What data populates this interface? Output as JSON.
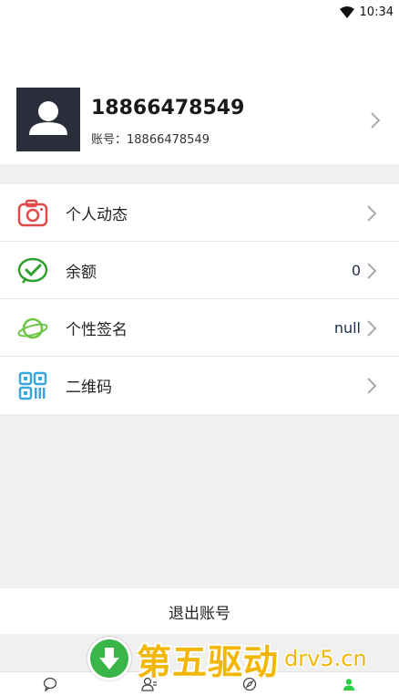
{
  "status_bar": {
    "time": "10:34",
    "wifi_icon": "wifi-icon"
  },
  "profile": {
    "name": "18866478549",
    "account_label": "账号：18866478549",
    "avatar_icon": "user-silhouette-icon"
  },
  "menu": {
    "items": [
      {
        "label": "个人动态",
        "value": "",
        "icon": "camera-icon",
        "color": "#e04a4a"
      },
      {
        "label": "余额",
        "value": "0",
        "icon": "wallet-check-icon",
        "color": "#2e9e2e"
      },
      {
        "label": "个性签名",
        "value": "null",
        "icon": "planet-icon",
        "color": "#6cc644"
      },
      {
        "label": "二维码",
        "value": "",
        "icon": "qr-code-icon",
        "color": "#3aa6e0"
      }
    ]
  },
  "logout": {
    "label": "退出账号"
  },
  "bottom_nav": {
    "items": [
      {
        "icon": "chat-icon"
      },
      {
        "icon": "contacts-icon"
      },
      {
        "icon": "compass-icon"
      },
      {
        "icon": "me-icon",
        "active": true,
        "color": "#2ecc40"
      }
    ]
  },
  "watermark": {
    "text": "第五驱动",
    "domain": "drv5.cn"
  }
}
